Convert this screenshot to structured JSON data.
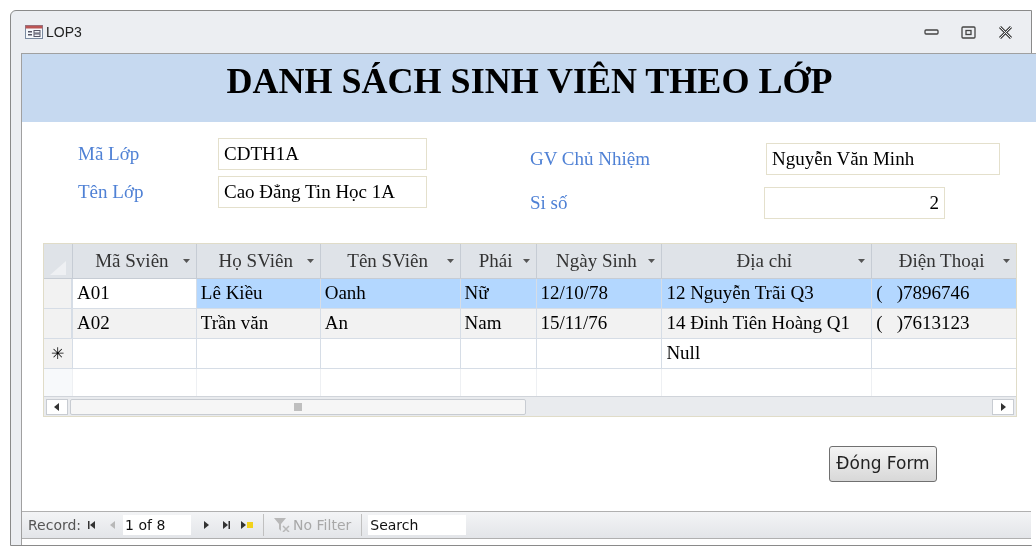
{
  "window": {
    "title": "LOP3"
  },
  "header": {
    "title": "DANH SÁCH SINH VIÊN THEO LỚP"
  },
  "fields": [
    {
      "label": "Mã Lớp",
      "value": "CDTH1A"
    },
    {
      "label": "Tên Lớp",
      "value": "Cao Đẳng Tin Học 1A"
    },
    {
      "label": "GV Chủ Nhiệm",
      "value": "Nguyễn Văn Minh"
    },
    {
      "label": "Si số",
      "value": "2"
    }
  ],
  "table": {
    "columns": [
      "Mã Sviên",
      "Họ SViên",
      "Tên SViên",
      "Phái",
      "Ngày Sinh",
      "Địa chỉ",
      "Điện Thoại"
    ],
    "rows": [
      {
        "selected": true,
        "cells": [
          "A01",
          "Lê Kiều",
          "Oanh",
          "Nữ",
          "12/10/78",
          "12 Nguyễn Trãi Q3",
          "(   )7896746"
        ]
      },
      {
        "selected": false,
        "cells": [
          "A02",
          "Trần văn",
          "An",
          "Nam",
          "15/11/76",
          "14 Đinh Tiên Hoàng Q1",
          "(   )7613123"
        ]
      }
    ],
    "new_row": {
      "marker": "✳",
      "dia_chi": "Null"
    }
  },
  "close_button": {
    "label": "Đóng Form"
  },
  "navigation": {
    "label": "Record:",
    "position": "1 of 8",
    "buttons": [
      {
        "kind": "first",
        "disabled": false
      },
      {
        "kind": "prev",
        "disabled": true
      }
    ],
    "buttons_after": [
      {
        "kind": "next",
        "disabled": false
      },
      {
        "kind": "last",
        "disabled": false
      },
      {
        "kind": "new",
        "disabled": false
      }
    ],
    "filter": {
      "label": "No Filter",
      "disabled": true
    },
    "search": {
      "placeholder": "Search"
    }
  }
}
